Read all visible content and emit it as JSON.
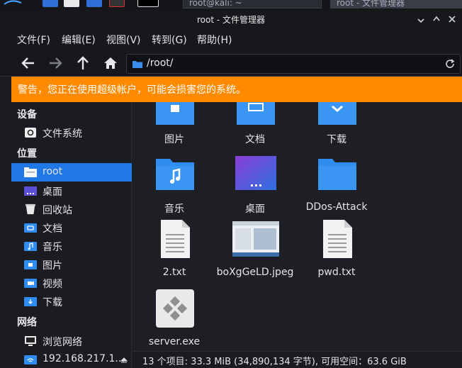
{
  "taskbar": {
    "tasks": [
      "root@kali: ~",
      "root - 文件管理器"
    ]
  },
  "window": {
    "title": "root - 文件管理器"
  },
  "menubar": {
    "items": [
      "文件(F)",
      "编辑(E)",
      "视图(V)",
      "转到(G)",
      "帮助(H)"
    ]
  },
  "toolbar": {
    "path": "/root/"
  },
  "warning": {
    "text": "警告，您正在使用超级帐户，可能会损害您的系统。"
  },
  "sidebar": {
    "devices_heading": "设备",
    "devices": [
      {
        "label": "文件系统",
        "icon": "drive-icon"
      }
    ],
    "places_heading": "位置",
    "places": [
      {
        "label": "root",
        "icon": "home-folder-icon",
        "active": true
      },
      {
        "label": "桌面",
        "icon": "desktop-folder-icon"
      },
      {
        "label": "回收站",
        "icon": "trash-icon"
      },
      {
        "label": "文档",
        "icon": "documents-folder-icon"
      },
      {
        "label": "音乐",
        "icon": "music-folder-icon"
      },
      {
        "label": "图片",
        "icon": "pictures-folder-icon"
      },
      {
        "label": "视频",
        "icon": "videos-folder-icon"
      },
      {
        "label": "下载",
        "icon": "downloads-folder-icon"
      }
    ],
    "network_heading": "网络",
    "network": [
      {
        "label": "浏览网络",
        "icon": "network-icon"
      },
      {
        "label": "192.168.217.1...",
        "icon": "network-share-icon"
      }
    ]
  },
  "files": [
    {
      "name": "图片",
      "type": "pictures-folder"
    },
    {
      "name": "文档",
      "type": "documents-folder"
    },
    {
      "name": "下载",
      "type": "downloads-folder"
    },
    {
      "name": "音乐",
      "type": "music-folder"
    },
    {
      "name": "桌面",
      "type": "desktop-folder"
    },
    {
      "name": "DDos-Attack",
      "type": "folder"
    },
    {
      "name": "2.txt",
      "type": "text-file"
    },
    {
      "name": "boXgGeLD.jpeg",
      "type": "image-file"
    },
    {
      "name": "pwd.txt",
      "type": "text-file"
    },
    {
      "name": "server.exe",
      "type": "executable-file"
    }
  ],
  "statusbar": {
    "text": "13 个项目: 33.3 MiB (34,890,134 字节), 可用空间：63.6 GiB"
  },
  "colors": {
    "accent": "#1f78e6",
    "warning": "#ff8a00",
    "folder": "#2f8cf0",
    "background": "#1e1f24"
  }
}
